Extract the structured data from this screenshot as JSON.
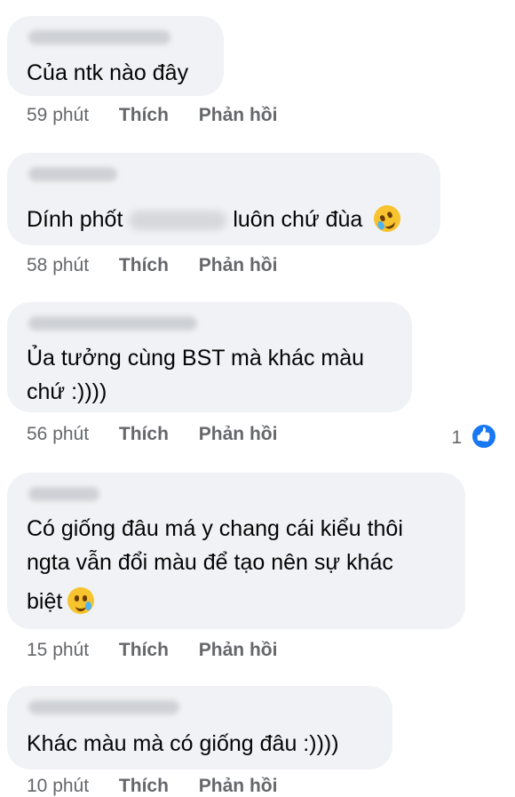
{
  "comments": [
    {
      "text_lines": [
        "Của ntk nào đây"
      ],
      "time": "59 phút",
      "like": "Thích",
      "reply": "Phản hồi"
    },
    {
      "text_before": "Dính phốt",
      "text_after": "luôn chứ đùa",
      "emoji": "rofl-emoji",
      "time": "58 phút",
      "like": "Thích",
      "reply": "Phản hồi"
    },
    {
      "text_lines": [
        "Ủa tưởng cùng BST mà khác màu",
        "chứ :))))"
      ],
      "time": "56 phút",
      "like": "Thích",
      "reply": "Phản hồi",
      "reaction_count": "1",
      "reaction_icon": "like-thumb-icon"
    },
    {
      "text_lines": [
        "Có giống đâu má y chang cái kiểu thôi",
        "ngta vẫn đổi màu để tạo nên sự khác",
        "biệt"
      ],
      "emoji": "smiling-tear-emoji",
      "time": "15 phút",
      "like": "Thích",
      "reply": "Phản hồi"
    },
    {
      "text_lines": [
        "Khác màu mà có giống đâu :))))"
      ],
      "time": "10 phút",
      "like": "Thích",
      "reply": "Phản hồi"
    }
  ]
}
